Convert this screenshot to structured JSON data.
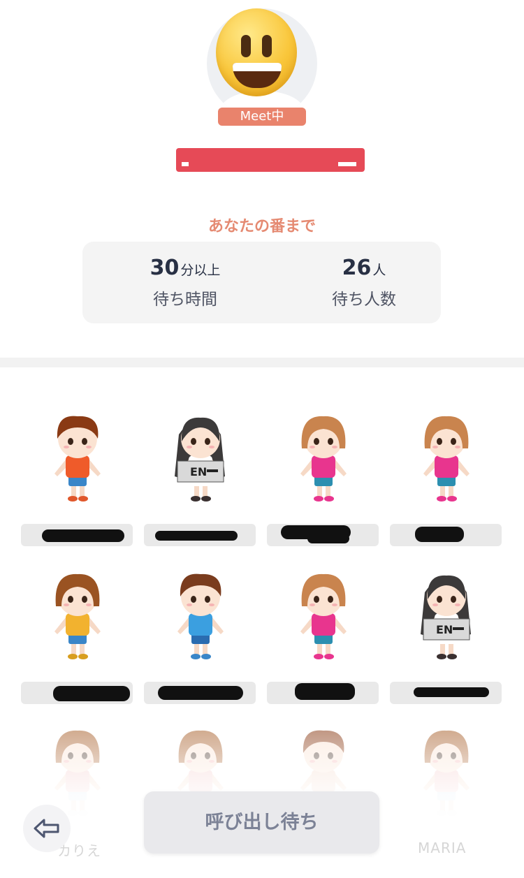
{
  "host": {
    "avatar_icon": "grinning-face-emoji-icon",
    "status": "Meet中",
    "name_redacted": true,
    "redaction_color": "#e64a57"
  },
  "queue_info": {
    "title": "あなたの番まで",
    "wait_time": {
      "value": "30",
      "unit": "分以上",
      "label": "待ち時間"
    },
    "people_waiting": {
      "value": "26",
      "unit": "人",
      "label": "待ち人数"
    }
  },
  "queue_members": [
    {
      "avatar": "boy-orange-shirt-avatar",
      "name_redacted": true
    },
    {
      "avatar": "girl-long-dark-hair-sign-avatar",
      "name_redacted": true,
      "sign_text": "EN"
    },
    {
      "avatar": "girl-bob-pink-shirt-avatar",
      "name_redacted": true
    },
    {
      "avatar": "girl-bob-pink-shirt-avatar",
      "name_redacted": true
    },
    {
      "avatar": "girl-bob-yellow-shirt-avatar",
      "name_redacted": true
    },
    {
      "avatar": "boy-blue-shirt-avatar",
      "name_redacted": true
    },
    {
      "avatar": "girl-bob-pink-shirt-avatar",
      "name_redacted": true
    },
    {
      "avatar": "girl-long-dark-hair-sign-avatar",
      "name_redacted": true,
      "sign_text": "EN"
    },
    {
      "avatar": "girl-bob-faded-avatar"
    },
    {
      "avatar": "girl-bob-faded-avatar"
    },
    {
      "avatar": "boy-spiky-faded-avatar"
    },
    {
      "avatar": "girl-bob-faded-avatar",
      "name": "MARIA"
    }
  ],
  "partial_name_left": "カりえ",
  "controls": {
    "back_icon": "arrow-left-icon",
    "call_label": "呼び出し待ち"
  },
  "colors": {
    "accent": "#e58a72",
    "badge": "#e9836c",
    "card_bg": "#f4f4f4",
    "button_bg": "#e9e9ec",
    "text_dark": "#283044"
  }
}
